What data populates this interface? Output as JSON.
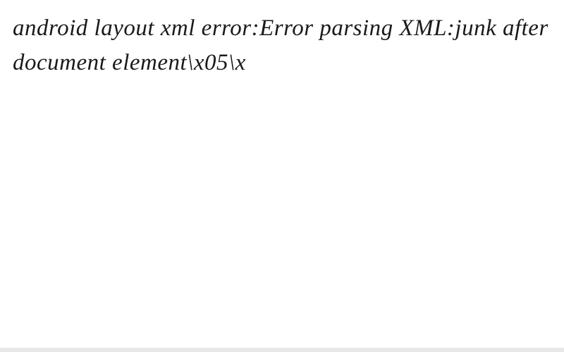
{
  "content": {
    "text": "android layout xml error:Error parsing XML:junk after document element\\x05\\x"
  }
}
